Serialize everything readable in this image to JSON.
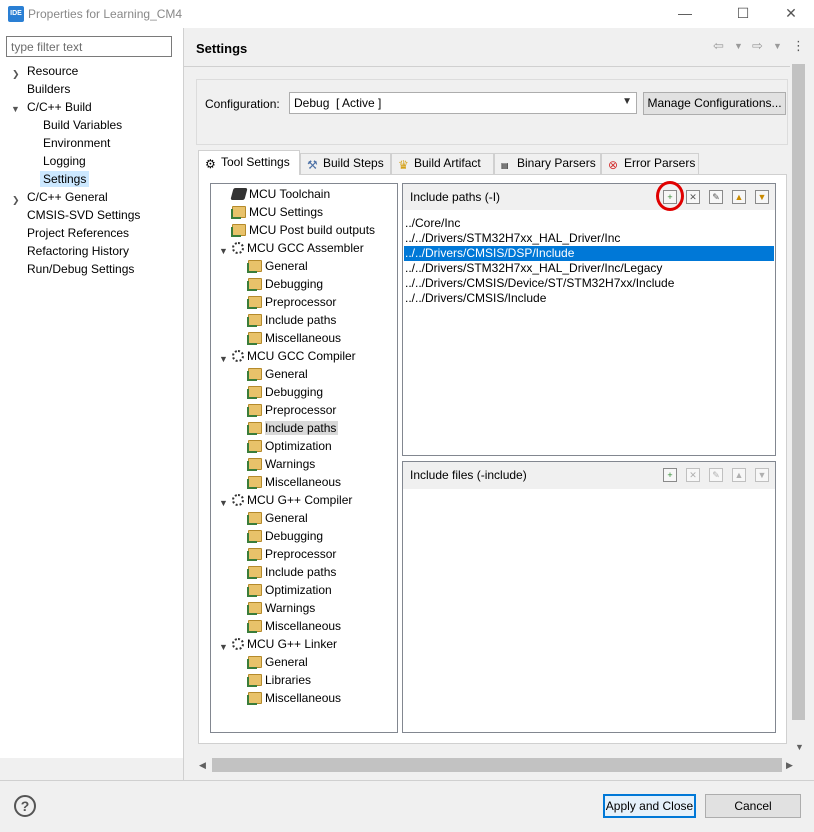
{
  "window": {
    "app_icon": "IDE",
    "title": "Properties for Learning_CM4",
    "minimize_glyph": "—",
    "maximize_glyph": "☐",
    "close_glyph": "✕"
  },
  "filter": {
    "placeholder": "type filter text"
  },
  "nav": {
    "items": [
      {
        "label": "Resource"
      },
      {
        "label": "Builders"
      },
      {
        "label": "C/C++ Build"
      },
      {
        "label": "Build Variables"
      },
      {
        "label": "Environment"
      },
      {
        "label": "Logging"
      },
      {
        "label": "Settings"
      },
      {
        "label": "C/C++ General"
      },
      {
        "label": "CMSIS-SVD Settings"
      },
      {
        "label": "Project References"
      },
      {
        "label": "Refactoring History"
      },
      {
        "label": "Run/Debug Settings"
      }
    ]
  },
  "page": {
    "title": "Settings",
    "config_label": "Configuration:",
    "config_value": "Debug  [ Active ]",
    "manage_button": "Manage Configurations..."
  },
  "tabs": [
    {
      "label": "Tool Settings",
      "icon": "gear-icon"
    },
    {
      "label": "Build Steps",
      "icon": "hammer-icon"
    },
    {
      "label": "Build Artifact",
      "icon": "trophy-icon"
    },
    {
      "label": "Binary Parsers",
      "icon": "binary-icon"
    },
    {
      "label": "Error Parsers",
      "icon": "error-icon"
    }
  ],
  "tool_tree": [
    {
      "label": "MCU Toolchain"
    },
    {
      "label": "MCU Settings"
    },
    {
      "label": "MCU Post build outputs"
    },
    {
      "label": "MCU GCC Assembler"
    },
    {
      "label": "General"
    },
    {
      "label": "Debugging"
    },
    {
      "label": "Preprocessor"
    },
    {
      "label": "Include paths"
    },
    {
      "label": "Miscellaneous"
    },
    {
      "label": "MCU GCC Compiler"
    },
    {
      "label": "General"
    },
    {
      "label": "Debugging"
    },
    {
      "label": "Preprocessor"
    },
    {
      "label": "Include paths"
    },
    {
      "label": "Optimization"
    },
    {
      "label": "Warnings"
    },
    {
      "label": "Miscellaneous"
    },
    {
      "label": "MCU G++ Compiler"
    },
    {
      "label": "General"
    },
    {
      "label": "Debugging"
    },
    {
      "label": "Preprocessor"
    },
    {
      "label": "Include paths"
    },
    {
      "label": "Optimization"
    },
    {
      "label": "Warnings"
    },
    {
      "label": "Miscellaneous"
    },
    {
      "label": "MCU G++ Linker"
    },
    {
      "label": "General"
    },
    {
      "label": "Libraries"
    },
    {
      "label": "Miscellaneous"
    }
  ],
  "include_paths": {
    "title": "Include paths (-I)",
    "rows": [
      "../Core/Inc",
      "../../Drivers/STM32H7xx_HAL_Driver/Inc",
      "../../Drivers/CMSIS/DSP/Include",
      "../../Drivers/STM32H7xx_HAL_Driver/Inc/Legacy",
      "../../Drivers/CMSIS/Device/ST/STM32H7xx/Include",
      "../../Drivers/CMSIS/Include"
    ]
  },
  "include_files": {
    "title": "Include files (-include)",
    "rows": []
  },
  "buttons": {
    "apply": "Apply and Close",
    "cancel": "Cancel",
    "help": "?"
  },
  "colors": {
    "selection": "#0078d7",
    "highlight": "#e00000"
  }
}
